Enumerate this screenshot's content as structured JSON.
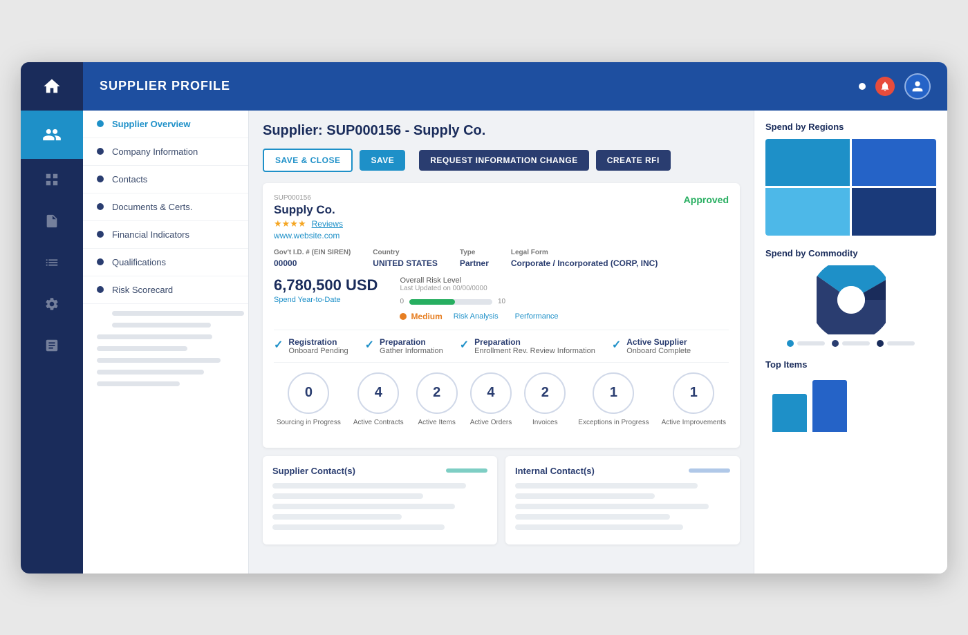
{
  "app": {
    "title": "SUPPLIER PROFILE"
  },
  "sidebar": {
    "home_label": "Home",
    "icons": [
      "suppliers-icon",
      "settings-icon",
      "reports-icon",
      "alerts-icon",
      "analytics-icon",
      "admin-icon"
    ]
  },
  "left_nav": {
    "items": [
      {
        "label": "Supplier Overview",
        "active": true
      },
      {
        "label": "Company Information",
        "active": false
      },
      {
        "label": "Contacts",
        "active": false
      },
      {
        "label": "Documents & Certs.",
        "active": false
      },
      {
        "label": "Financial Indicators",
        "active": false
      },
      {
        "label": "Qualifications",
        "active": false
      },
      {
        "label": "Risk Scorecard",
        "active": false
      }
    ]
  },
  "header": {
    "supplier_title": "Supplier: SUP000156 - Supply Co."
  },
  "action_bar": {
    "save_close": "SAVE & CLOSE",
    "save": "SAVE",
    "request_change": "REQUEST INFORMATION CHANGE",
    "create_rfi": "CREATE RFI"
  },
  "supplier_card": {
    "id": "SUP000156",
    "name": "Supply Co.",
    "stars": "★★★★",
    "reviews": "Reviews",
    "website": "www.website.com",
    "status": "Approved",
    "gov_id_label": "Gov't I.D. # (EIN SIREN)",
    "gov_id_value": "00000",
    "country_label": "Country",
    "country_value": "UNITED STATES",
    "type_label": "Type",
    "type_value": "Partner",
    "legal_form_label": "Legal Form",
    "legal_form_value": "Corporate / Incorporated (CORP, INC)",
    "spend_amount": "6,780,500 USD",
    "spend_year_label": "Spend Year-to-Date",
    "risk_label": "Overall Risk Level",
    "risk_updated": "Last Updated on 00/00/0000",
    "risk_min": "0",
    "risk_max": "10",
    "risk_fill_pct": "55",
    "risk_level": "Medium",
    "risk_analysis": "Risk Analysis",
    "performance": "Performance"
  },
  "steps": [
    {
      "title": "Registration",
      "sub": "Onboard Pending"
    },
    {
      "title": "Preparation",
      "sub": "Gather Information"
    },
    {
      "title": "Preparation",
      "sub": "Enrollment Rev. Review Information"
    },
    {
      "title": "Active Supplier",
      "sub": "Onboard Complete"
    }
  ],
  "metrics": [
    {
      "value": "0",
      "label": "Sourcing in Progress"
    },
    {
      "value": "4",
      "label": "Active Contracts"
    },
    {
      "value": "2",
      "label": "Active Items"
    },
    {
      "value": "4",
      "label": "Active Orders"
    },
    {
      "value": "2",
      "label": "Invoices"
    },
    {
      "value": "1",
      "label": "Exceptions in Progress"
    },
    {
      "value": "1",
      "label": "Active Improvements"
    }
  ],
  "contacts": {
    "supplier_title": "Supplier Contact(s)",
    "internal_title": "Internal Contact(s)"
  },
  "right_panel": {
    "spend_regions_title": "Spend by Regions",
    "spend_commodity_title": "Spend by Commodity",
    "top_items_title": "Top Items",
    "legend": [
      {
        "color": "teal",
        "label": ""
      },
      {
        "color": "navy",
        "label": ""
      },
      {
        "color": "dark",
        "label": ""
      }
    ]
  }
}
